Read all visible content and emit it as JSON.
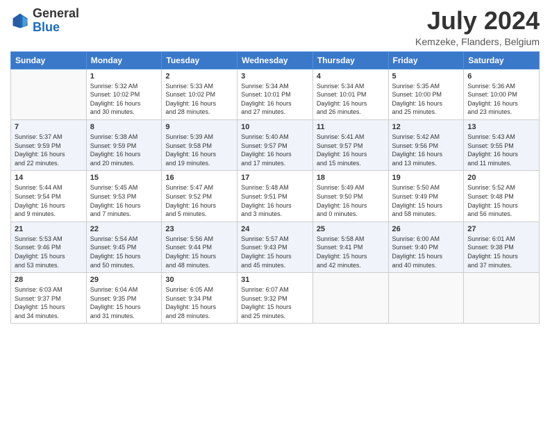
{
  "logo": {
    "general": "General",
    "blue": "Blue"
  },
  "title": {
    "month_year": "July 2024",
    "location": "Kemzeke, Flanders, Belgium"
  },
  "weekdays": [
    "Sunday",
    "Monday",
    "Tuesday",
    "Wednesday",
    "Thursday",
    "Friday",
    "Saturday"
  ],
  "weeks": [
    [
      {
        "day": "",
        "sunrise": "",
        "sunset": "",
        "daylight": ""
      },
      {
        "day": "1",
        "sunrise": "Sunrise: 5:32 AM",
        "sunset": "Sunset: 10:02 PM",
        "daylight": "Daylight: 16 hours and 30 minutes."
      },
      {
        "day": "2",
        "sunrise": "Sunrise: 5:33 AM",
        "sunset": "Sunset: 10:02 PM",
        "daylight": "Daylight: 16 hours and 28 minutes."
      },
      {
        "day": "3",
        "sunrise": "Sunrise: 5:34 AM",
        "sunset": "Sunset: 10:01 PM",
        "daylight": "Daylight: 16 hours and 27 minutes."
      },
      {
        "day": "4",
        "sunrise": "Sunrise: 5:34 AM",
        "sunset": "Sunset: 10:01 PM",
        "daylight": "Daylight: 16 hours and 26 minutes."
      },
      {
        "day": "5",
        "sunrise": "Sunrise: 5:35 AM",
        "sunset": "Sunset: 10:00 PM",
        "daylight": "Daylight: 16 hours and 25 minutes."
      },
      {
        "day": "6",
        "sunrise": "Sunrise: 5:36 AM",
        "sunset": "Sunset: 10:00 PM",
        "daylight": "Daylight: 16 hours and 23 minutes."
      }
    ],
    [
      {
        "day": "7",
        "sunrise": "Sunrise: 5:37 AM",
        "sunset": "Sunset: 9:59 PM",
        "daylight": "Daylight: 16 hours and 22 minutes."
      },
      {
        "day": "8",
        "sunrise": "Sunrise: 5:38 AM",
        "sunset": "Sunset: 9:59 PM",
        "daylight": "Daylight: 16 hours and 20 minutes."
      },
      {
        "day": "9",
        "sunrise": "Sunrise: 5:39 AM",
        "sunset": "Sunset: 9:58 PM",
        "daylight": "Daylight: 16 hours and 19 minutes."
      },
      {
        "day": "10",
        "sunrise": "Sunrise: 5:40 AM",
        "sunset": "Sunset: 9:57 PM",
        "daylight": "Daylight: 16 hours and 17 minutes."
      },
      {
        "day": "11",
        "sunrise": "Sunrise: 5:41 AM",
        "sunset": "Sunset: 9:57 PM",
        "daylight": "Daylight: 16 hours and 15 minutes."
      },
      {
        "day": "12",
        "sunrise": "Sunrise: 5:42 AM",
        "sunset": "Sunset: 9:56 PM",
        "daylight": "Daylight: 16 hours and 13 minutes."
      },
      {
        "day": "13",
        "sunrise": "Sunrise: 5:43 AM",
        "sunset": "Sunset: 9:55 PM",
        "daylight": "Daylight: 16 hours and 11 minutes."
      }
    ],
    [
      {
        "day": "14",
        "sunrise": "Sunrise: 5:44 AM",
        "sunset": "Sunset: 9:54 PM",
        "daylight": "Daylight: 16 hours and 9 minutes."
      },
      {
        "day": "15",
        "sunrise": "Sunrise: 5:45 AM",
        "sunset": "Sunset: 9:53 PM",
        "daylight": "Daylight: 16 hours and 7 minutes."
      },
      {
        "day": "16",
        "sunrise": "Sunrise: 5:47 AM",
        "sunset": "Sunset: 9:52 PM",
        "daylight": "Daylight: 16 hours and 5 minutes."
      },
      {
        "day": "17",
        "sunrise": "Sunrise: 5:48 AM",
        "sunset": "Sunset: 9:51 PM",
        "daylight": "Daylight: 16 hours and 3 minutes."
      },
      {
        "day": "18",
        "sunrise": "Sunrise: 5:49 AM",
        "sunset": "Sunset: 9:50 PM",
        "daylight": "Daylight: 16 hours and 0 minutes."
      },
      {
        "day": "19",
        "sunrise": "Sunrise: 5:50 AM",
        "sunset": "Sunset: 9:49 PM",
        "daylight": "Daylight: 15 hours and 58 minutes."
      },
      {
        "day": "20",
        "sunrise": "Sunrise: 5:52 AM",
        "sunset": "Sunset: 9:48 PM",
        "daylight": "Daylight: 15 hours and 56 minutes."
      }
    ],
    [
      {
        "day": "21",
        "sunrise": "Sunrise: 5:53 AM",
        "sunset": "Sunset: 9:46 PM",
        "daylight": "Daylight: 15 hours and 53 minutes."
      },
      {
        "day": "22",
        "sunrise": "Sunrise: 5:54 AM",
        "sunset": "Sunset: 9:45 PM",
        "daylight": "Daylight: 15 hours and 50 minutes."
      },
      {
        "day": "23",
        "sunrise": "Sunrise: 5:56 AM",
        "sunset": "Sunset: 9:44 PM",
        "daylight": "Daylight: 15 hours and 48 minutes."
      },
      {
        "day": "24",
        "sunrise": "Sunrise: 5:57 AM",
        "sunset": "Sunset: 9:43 PM",
        "daylight": "Daylight: 15 hours and 45 minutes."
      },
      {
        "day": "25",
        "sunrise": "Sunrise: 5:58 AM",
        "sunset": "Sunset: 9:41 PM",
        "daylight": "Daylight: 15 hours and 42 minutes."
      },
      {
        "day": "26",
        "sunrise": "Sunrise: 6:00 AM",
        "sunset": "Sunset: 9:40 PM",
        "daylight": "Daylight: 15 hours and 40 minutes."
      },
      {
        "day": "27",
        "sunrise": "Sunrise: 6:01 AM",
        "sunset": "Sunset: 9:38 PM",
        "daylight": "Daylight: 15 hours and 37 minutes."
      }
    ],
    [
      {
        "day": "28",
        "sunrise": "Sunrise: 6:03 AM",
        "sunset": "Sunset: 9:37 PM",
        "daylight": "Daylight: 15 hours and 34 minutes."
      },
      {
        "day": "29",
        "sunrise": "Sunrise: 6:04 AM",
        "sunset": "Sunset: 9:35 PM",
        "daylight": "Daylight: 15 hours and 31 minutes."
      },
      {
        "day": "30",
        "sunrise": "Sunrise: 6:05 AM",
        "sunset": "Sunset: 9:34 PM",
        "daylight": "Daylight: 15 hours and 28 minutes."
      },
      {
        "day": "31",
        "sunrise": "Sunrise: 6:07 AM",
        "sunset": "Sunset: 9:32 PM",
        "daylight": "Daylight: 15 hours and 25 minutes."
      },
      {
        "day": "",
        "sunrise": "",
        "sunset": "",
        "daylight": ""
      },
      {
        "day": "",
        "sunrise": "",
        "sunset": "",
        "daylight": ""
      },
      {
        "day": "",
        "sunrise": "",
        "sunset": "",
        "daylight": ""
      }
    ]
  ]
}
